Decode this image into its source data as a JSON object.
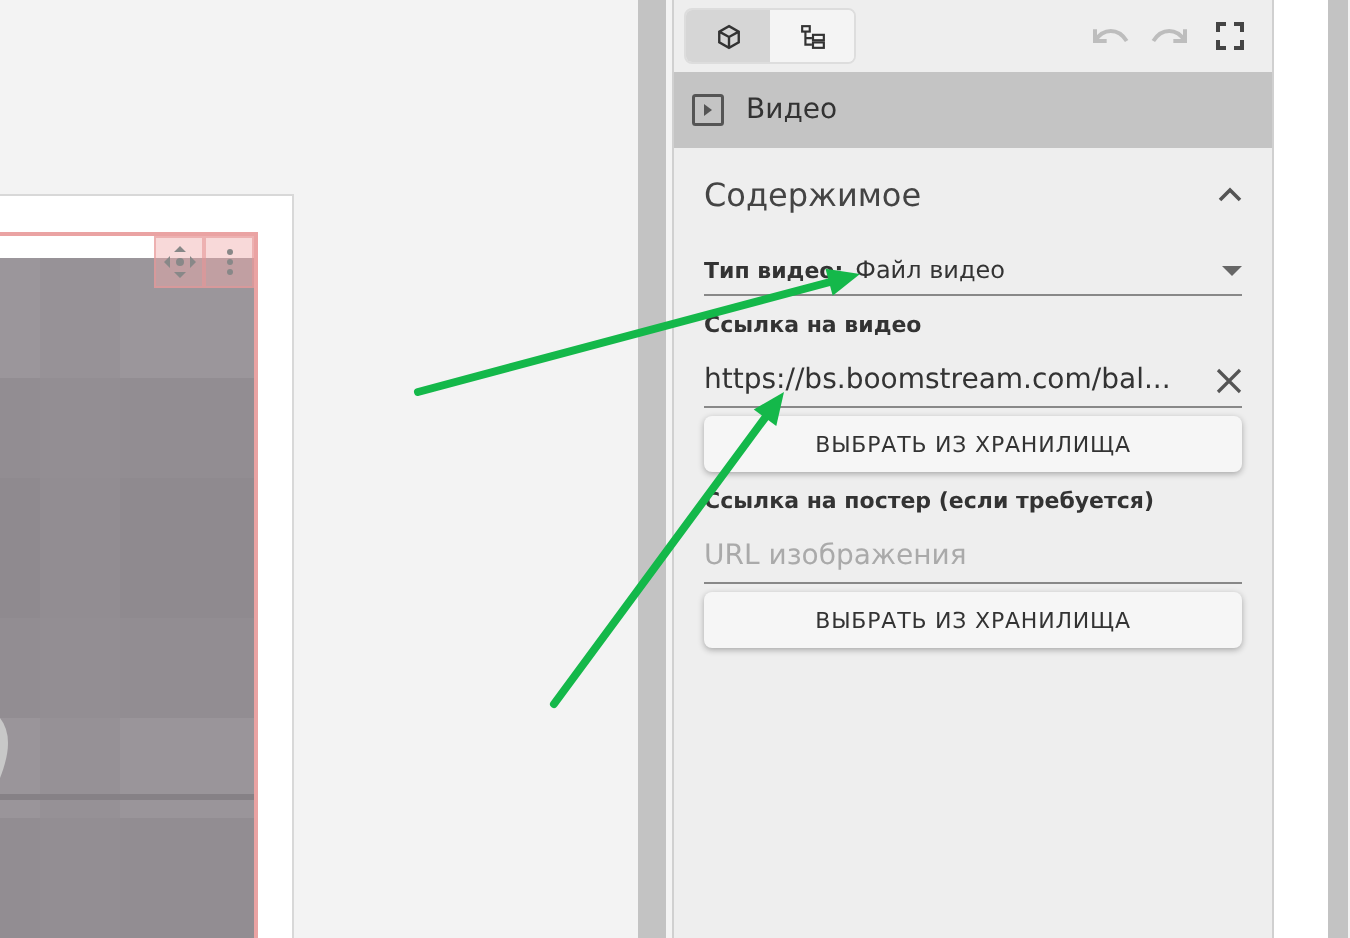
{
  "toolbar": {
    "view_tabs": [
      {
        "kind": "cube",
        "selected": true
      },
      {
        "kind": "tree",
        "selected": false
      }
    ],
    "actions": [
      {
        "kind": "undo",
        "disabled": true
      },
      {
        "kind": "redo",
        "disabled": true
      },
      {
        "kind": "fullscreen",
        "disabled": false
      }
    ]
  },
  "block": {
    "title": "Видео"
  },
  "section": {
    "title": "Содержимое",
    "expanded": true,
    "fields": [
      {
        "kind": "select",
        "label": "Тип видео:",
        "value": "Файл видео"
      },
      {
        "kind": "url",
        "label": "Ссылка на видео",
        "value": "https://bs.boomstream.com/bal...",
        "button": "ВЫБРАТЬ ИЗ ХРАНИЛИЩА"
      },
      {
        "kind": "url",
        "label": "Ссылка на постер (если требуется)",
        "placeholder": "URL изображения",
        "button": "ВЫБРАТЬ ИЗ ХРАНИЛИЩА"
      }
    ]
  }
}
